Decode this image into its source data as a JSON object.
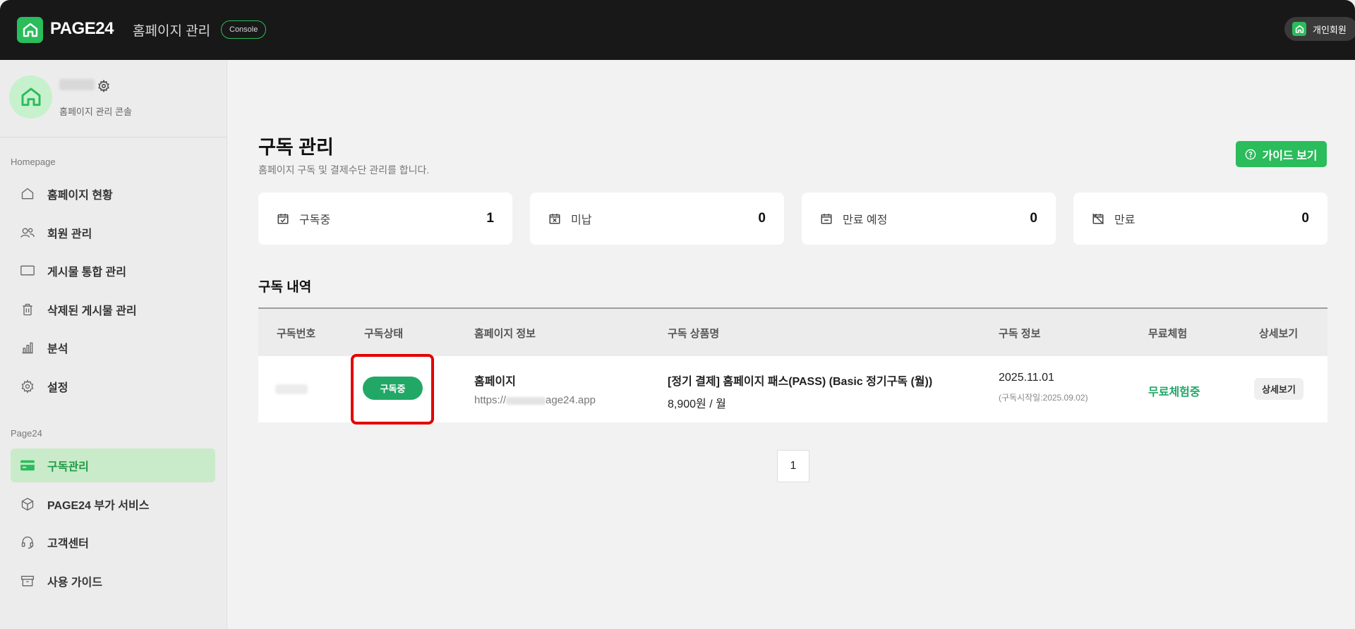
{
  "topbar": {
    "logo_text": "PAGE24",
    "title": "홈페이지 관리",
    "console_badge": "Console",
    "user_chip_label": "개인회원"
  },
  "sidebar": {
    "profile_subtitle": "홈페이지 관리 콘솔",
    "section_homepage": "Homepage",
    "section_page24": "Page24",
    "items": [
      {
        "label": "홈페이지 현황",
        "icon": "home-icon"
      },
      {
        "label": "회원 관리",
        "icon": "users-icon"
      },
      {
        "label": "게시물 통합 관리",
        "icon": "monitor-icon"
      },
      {
        "label": "삭제된 게시물 관리",
        "icon": "trash-icon"
      },
      {
        "label": "분석",
        "icon": "bar-chart-icon"
      },
      {
        "label": "설정",
        "icon": "gear-icon"
      },
      {
        "label": "구독관리",
        "icon": "credit-card-icon",
        "active": true
      },
      {
        "label": "PAGE24 부가 서비스",
        "icon": "box-icon"
      },
      {
        "label": "고객센터",
        "icon": "headset-icon"
      },
      {
        "label": "사용 가이드",
        "icon": "archive-icon"
      }
    ]
  },
  "main": {
    "title": "구독 관리",
    "description": "홈페이지 구독 및 결제수단 관리를 합니다.",
    "guide_button": "가이드 보기",
    "stats": [
      {
        "label": "구독중",
        "value": "1",
        "icon": "calendar-check-icon"
      },
      {
        "label": "미납",
        "value": "0",
        "icon": "calendar-x-icon"
      },
      {
        "label": "만료 예정",
        "value": "0",
        "icon": "calendar-minus-icon"
      },
      {
        "label": "만료",
        "value": "0",
        "icon": "calendar-off-icon"
      }
    ],
    "section_title": "구독 내역",
    "columns": [
      "구독번호",
      "구독상태",
      "홈페이지 정보",
      "구독 상품명",
      "구독 정보",
      "무료체험",
      "상세보기"
    ],
    "row": {
      "status": "구독중",
      "homepage_name": "홈페이지",
      "homepage_url_prefix": "https://",
      "homepage_url_suffix": "age24.app",
      "product_name": "[정기 결제] 홈페이지 패스(PASS) (Basic 정기구독 (월))",
      "product_price": "8,900원 / 월",
      "sub_date": "2025.11.01",
      "sub_start": "(구독시작일:2025.09.02)",
      "free_trial": "무료체험중",
      "detail_button": "상세보기"
    },
    "pager": "1"
  },
  "colors": {
    "brand_green": "#2bbc5b",
    "status_green": "#21a867",
    "highlight_red": "#e40000"
  }
}
